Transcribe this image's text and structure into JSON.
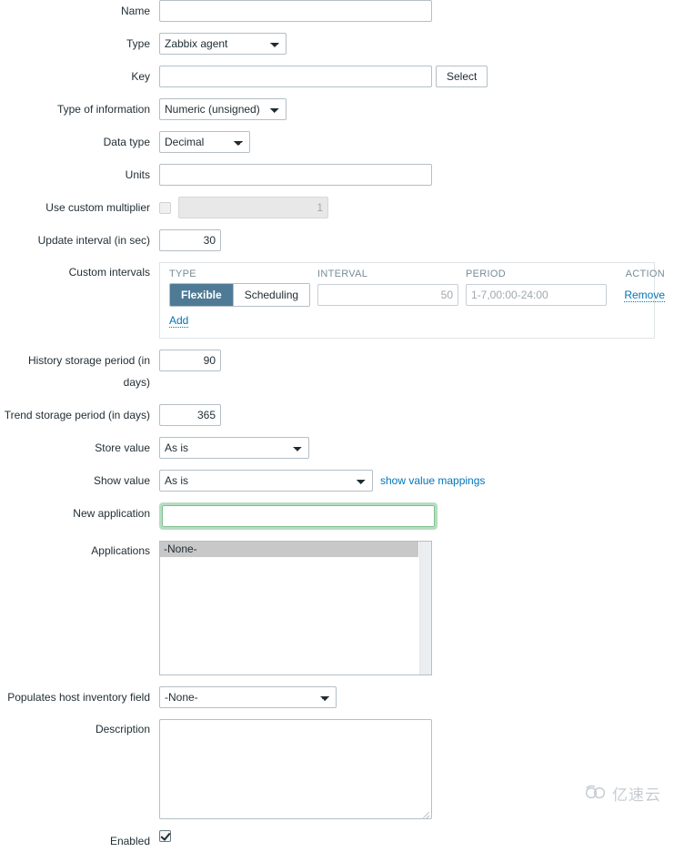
{
  "form": {
    "name": {
      "label": "Name",
      "value": "",
      "placeholder": ""
    },
    "type": {
      "label": "Type",
      "value": "Zabbix agent",
      "options": [
        "Zabbix agent"
      ]
    },
    "key": {
      "label": "Key",
      "value": "",
      "placeholder": "",
      "select_button": "Select"
    },
    "type_of_information": {
      "label": "Type of information",
      "value": "Numeric (unsigned)",
      "options": [
        "Numeric (unsigned)"
      ]
    },
    "data_type": {
      "label": "Data type",
      "value": "Decimal",
      "options": [
        "Decimal"
      ]
    },
    "units": {
      "label": "Units",
      "value": "",
      "placeholder": ""
    },
    "use_custom_multiplier": {
      "label": "Use custom multiplier",
      "checked": false,
      "multiplier_value": "",
      "multiplier_placeholder": "1",
      "disabled": true
    },
    "update_interval": {
      "label": "Update interval (in sec)",
      "value": "30"
    },
    "custom_intervals": {
      "label": "Custom intervals",
      "headers": [
        "TYPE",
        "INTERVAL",
        "PERIOD",
        "ACTION"
      ],
      "rows": [
        {
          "type_options": [
            "Flexible",
            "Scheduling"
          ],
          "type_selected": "Flexible",
          "interval_value": "",
          "interval_placeholder": "50",
          "period_value": "",
          "period_placeholder": "1-7,00:00-24:00",
          "action_label": "Remove"
        }
      ],
      "add_label": "Add"
    },
    "history_storage_period": {
      "label": "History storage period (in days)",
      "value": "90"
    },
    "trend_storage_period": {
      "label": "Trend storage period (in days)",
      "value": "365"
    },
    "store_value": {
      "label": "Store value",
      "value": "As is",
      "options": [
        "As is"
      ]
    },
    "show_value": {
      "label": "Show value",
      "value": "As is",
      "options": [
        "As is"
      ],
      "mappings_link": "show value mappings"
    },
    "new_application": {
      "label": "New application",
      "value": "",
      "placeholder": "",
      "focused": true
    },
    "applications": {
      "label": "Applications",
      "options": [
        "-None-"
      ],
      "selected": "-None-"
    },
    "host_inventory_field": {
      "label": "Populates host inventory field",
      "value": "-None-",
      "options": [
        "-None-"
      ]
    },
    "description": {
      "label": "Description",
      "value": "",
      "placeholder": ""
    },
    "enabled": {
      "label": "Enabled",
      "checked": true
    }
  },
  "watermark": {
    "text": "亿速云",
    "icon": "cloud-icon"
  },
  "colors": {
    "accent": "#0275b8",
    "selected_tab": "#4f7a96",
    "focus_ring": "#b6ddc0",
    "border": "#b4bfc6",
    "header_text": "#768d99"
  }
}
